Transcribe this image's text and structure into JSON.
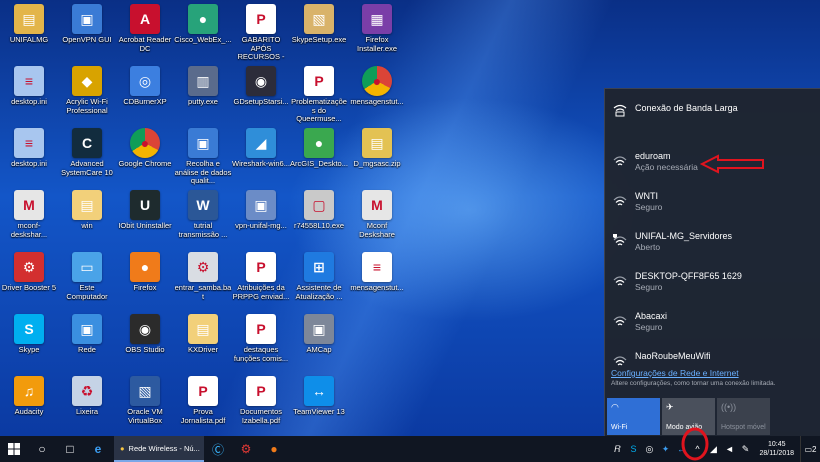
{
  "desktop": {
    "icons": [
      {
        "label": "UNIFALMG",
        "glyph": "folder-icon",
        "color": "#e3b54a",
        "sym": "▤"
      },
      {
        "label": "OpenVPN GUI",
        "glyph": "monitor-network-icon",
        "color": "#3a7bd5",
        "sym": "▣"
      },
      {
        "label": "Acrobat Reader DC",
        "glyph": "acrobat-icon",
        "color": "#c8102e",
        "sym": "A"
      },
      {
        "label": "Cisco_WebEx_...",
        "glyph": "webex-icon",
        "color": "#27a37a",
        "sym": "●"
      },
      {
        "label": "GABARITO APÓS RECURSOS - Jo...",
        "glyph": "pdf-file-icon",
        "color": "#ffffff",
        "sym": "P"
      },
      {
        "label": "SkypeSetup.exe",
        "glyph": "installer-box-icon",
        "color": "#d9b36a",
        "sym": "▧"
      },
      {
        "label": "Firefox Installer.exe",
        "glyph": "installer-icon",
        "color": "#7a3ea8",
        "sym": "▦"
      },
      {
        "label": "desktop.ini",
        "glyph": "ini-file-icon",
        "color": "#a8c6ef",
        "sym": "≡"
      },
      {
        "label": "Acrylic Wi-Fi Professional",
        "glyph": "acrylic-icon",
        "color": "#d8a300",
        "sym": "◆"
      },
      {
        "label": "CDBurnerXP",
        "glyph": "cd-icon",
        "color": "#3c7fe0",
        "sym": "◎"
      },
      {
        "label": "putty.exe",
        "glyph": "putty-icon",
        "color": "#5a6b8c",
        "sym": "▥"
      },
      {
        "label": "GDsetupStarsi...",
        "glyph": "setup-icon",
        "color": "#2c2c3a",
        "sym": "◉"
      },
      {
        "label": "Problematizações do Queermuse...",
        "glyph": "pptx-file-icon",
        "color": "#ffffff",
        "sym": "P"
      },
      {
        "label": "mensagenstut...",
        "glyph": "chrome-icon",
        "color": "#ffffff",
        "sym": "●"
      },
      {
        "label": "desktop.ini",
        "glyph": "ini-file-icon",
        "color": "#a8c6ef",
        "sym": "≡"
      },
      {
        "label": "Advanced SystemCare 10",
        "glyph": "systemcare-icon",
        "color": "#122c3e",
        "sym": "C"
      },
      {
        "label": "Google Chrome",
        "glyph": "chrome-icon",
        "color": "#ffffff",
        "sym": "●"
      },
      {
        "label": "Recolha e análise de dados qualit...",
        "glyph": "presentation-icon",
        "color": "#3a7bd5",
        "sym": "▣"
      },
      {
        "label": "Wireshark-win6...",
        "glyph": "wireshark-icon",
        "color": "#2f8ed9",
        "sym": "◢"
      },
      {
        "label": "ArcGIS_Deskto...",
        "glyph": "arcgis-icon",
        "color": "#3aa84f",
        "sym": "●"
      },
      {
        "label": "D_mgsasc.zip",
        "glyph": "zip-icon",
        "color": "#e3c253",
        "sym": "▤"
      },
      {
        "label": "mconf-deskshar...",
        "glyph": "mconf-icon",
        "color": "#e6e6e6",
        "sym": "M"
      },
      {
        "label": "win",
        "glyph": "folder-icon",
        "color": "#f2d07a",
        "sym": "▤"
      },
      {
        "label": "IObit Uninstaller",
        "glyph": "iobit-icon",
        "color": "#1e2b2e",
        "sym": "U"
      },
      {
        "label": "tutrial transmissão ...",
        "glyph": "word-file-icon",
        "color": "#2b5797",
        "sym": "W"
      },
      {
        "label": "vpn-unifal-mg...",
        "glyph": "installer-window-icon",
        "color": "#6b8cc7",
        "sym": "▣"
      },
      {
        "label": "r74558L10.exe",
        "glyph": "exe-icon",
        "color": "#c9c9c9",
        "sym": "▢"
      },
      {
        "label": "Mconf Deskshare",
        "glyph": "mconf-icon",
        "color": "#e6e6e6",
        "sym": "M"
      },
      {
        "label": "Driver Booster 5",
        "glyph": "driver-booster-icon",
        "color": "#d32f2f",
        "sym": "⚙"
      },
      {
        "label": "Este Computador",
        "glyph": "computer-icon",
        "color": "#4aa3e8",
        "sym": "▭"
      },
      {
        "label": "Firefox",
        "glyph": "firefox-icon",
        "color": "#f07b1a",
        "sym": "●"
      },
      {
        "label": "entrar_samba.bat",
        "glyph": "batch-file-icon",
        "color": "#d9dde3",
        "sym": "⚙"
      },
      {
        "label": "Atribuições da PRPPG enviad...",
        "glyph": "pdf-file-icon",
        "color": "#ffffff",
        "sym": "P"
      },
      {
        "label": "Assistente de Atualização ...",
        "glyph": "windows-icon",
        "color": "#1f7ae0",
        "sym": "⊞"
      },
      {
        "label": "mensagenstut...",
        "glyph": "text-file-icon",
        "color": "#ffffff",
        "sym": "≡"
      },
      {
        "label": "Skype",
        "glyph": "skype-icon",
        "color": "#00aff0",
        "sym": "S"
      },
      {
        "label": "Rede",
        "glyph": "network-icon",
        "color": "#3a8fe0",
        "sym": "▣"
      },
      {
        "label": "OBS Studio",
        "glyph": "obs-icon",
        "color": "#2b2b2b",
        "sym": "◉"
      },
      {
        "label": "KXDriver",
        "glyph": "folder-icon",
        "color": "#f2d07a",
        "sym": "▤"
      },
      {
        "label": "destaques funções comis...",
        "glyph": "pdf-file-icon",
        "color": "#ffffff",
        "sym": "P"
      },
      {
        "label": "AMCap",
        "glyph": "camera-icon",
        "color": "#7d8799",
        "sym": "▣"
      },
      {
        "label": "",
        "glyph": "",
        "color": "",
        "sym": ""
      },
      {
        "label": "Audacity",
        "glyph": "audacity-icon",
        "color": "#f29b0c",
        "sym": "♫"
      },
      {
        "label": "Lixeira",
        "glyph": "recycle-bin-icon",
        "color": "#c5d3e6",
        "sym": "♻"
      },
      {
        "label": "Oracle VM VirtualBox",
        "glyph": "virtualbox-icon",
        "color": "#2d5aa0",
        "sym": "▧"
      },
      {
        "label": "Prova Jornalista.pdf",
        "glyph": "pdf-file-icon",
        "color": "#ffffff",
        "sym": "P"
      },
      {
        "label": "Documentos Izabella.pdf",
        "glyph": "pdf-file-icon",
        "color": "#ffffff",
        "sym": "P"
      },
      {
        "label": "TeamViewer 13",
        "glyph": "teamviewer-icon",
        "color": "#0e8ee9",
        "sym": "↔"
      },
      {
        "label": "",
        "glyph": "",
        "color": "",
        "sym": ""
      }
    ]
  },
  "flyout": {
    "broadband": {
      "label": "Conexão de Banda Larga"
    },
    "networks": [
      {
        "ssid": "eduroam",
        "status": "Ação necessária",
        "secured": true
      },
      {
        "ssid": "WNTI",
        "status": "Seguro",
        "secured": true
      },
      {
        "ssid": "UNIFAL-MG_Servidores",
        "status": "Aberto",
        "secured": false
      },
      {
        "ssid": "DESKTOP-QFF8F65 1629",
        "status": "Seguro",
        "secured": true
      },
      {
        "ssid": "Abacaxi",
        "status": "Seguro",
        "secured": true
      },
      {
        "ssid": "NaoRoubeMeuWifi",
        "status": "",
        "secured": true
      }
    ],
    "settings": {
      "link": "Configurações de Rede e Internet",
      "desc": "Altere configurações, como tornar uma conexão limitada."
    },
    "quick_actions": [
      {
        "label": "Wi-Fi",
        "state": "on"
      },
      {
        "label": "Modo avião",
        "state": "off"
      },
      {
        "label": "Hotspot móvel",
        "state": "disabled"
      }
    ]
  },
  "taskbar": {
    "app_label": "Rede Wireless - Nú...",
    "clock_time": "10:45",
    "clock_date": "28/11/2018",
    "notification_count": "2"
  },
  "annotations": {
    "color": "#e0141e"
  }
}
